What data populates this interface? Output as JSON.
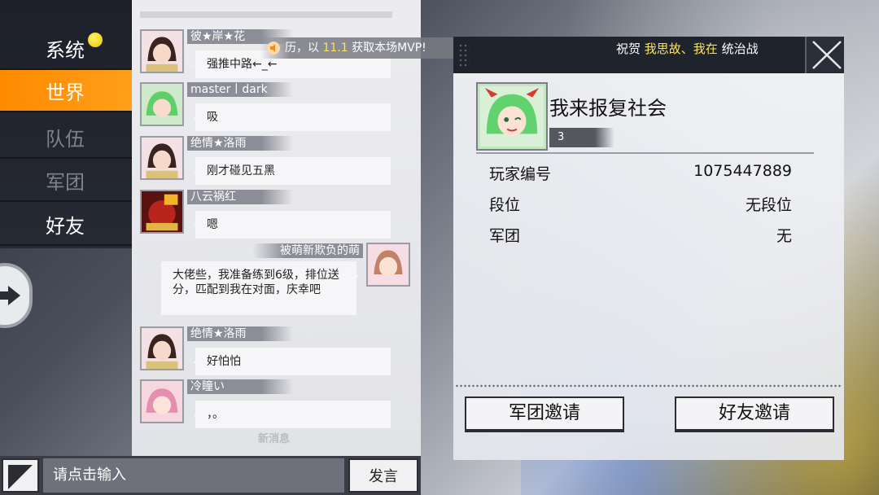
{
  "sidebar": {
    "items": [
      {
        "label": "系统"
      },
      {
        "label": "世界"
      },
      {
        "label": "队伍"
      },
      {
        "label": "军团"
      },
      {
        "label": "好友"
      }
    ]
  },
  "banner": {
    "pre": "历，以",
    "number": "11.1",
    "post": "获取本场MVP!"
  },
  "chat": {
    "messages": [
      {
        "name": "彼★岸★花",
        "text": "强推中路←_←"
      },
      {
        "name": "master丨dark",
        "text": "吸"
      },
      {
        "name": "绝情★洛雨",
        "text": "刚才碰见五黑"
      },
      {
        "name": "八云祸红",
        "text": "嗯"
      },
      {
        "name": "被萌新欺负的萌",
        "text": "大佬些，我准备练到6级，排位送分，匹配到我在对面，庆幸吧"
      },
      {
        "name": "绝情★洛雨",
        "text": "好怕怕"
      },
      {
        "name": "冷瞳い",
        "text": "，。"
      }
    ],
    "new_message_label": "新消息"
  },
  "input": {
    "placeholder": "请点击输入",
    "send_label": "发言"
  },
  "profile": {
    "marquee_pre": "祝贺",
    "marquee_hl": "我思故、我在",
    "marquee_post": "统治战",
    "name": "我来报复社会",
    "level": "3",
    "rows": [
      {
        "label": "玩家编号",
        "value": "1075447889"
      },
      {
        "label": "段位",
        "value": "无段位"
      },
      {
        "label": "军团",
        "value": "无"
      }
    ],
    "legion_invite_label": "军团邀请",
    "friend_invite_label": "好友邀请"
  },
  "colors": {
    "accent": "#ff8a00",
    "highlight": "#ffe44d",
    "panel_dark": "#1f232c"
  }
}
